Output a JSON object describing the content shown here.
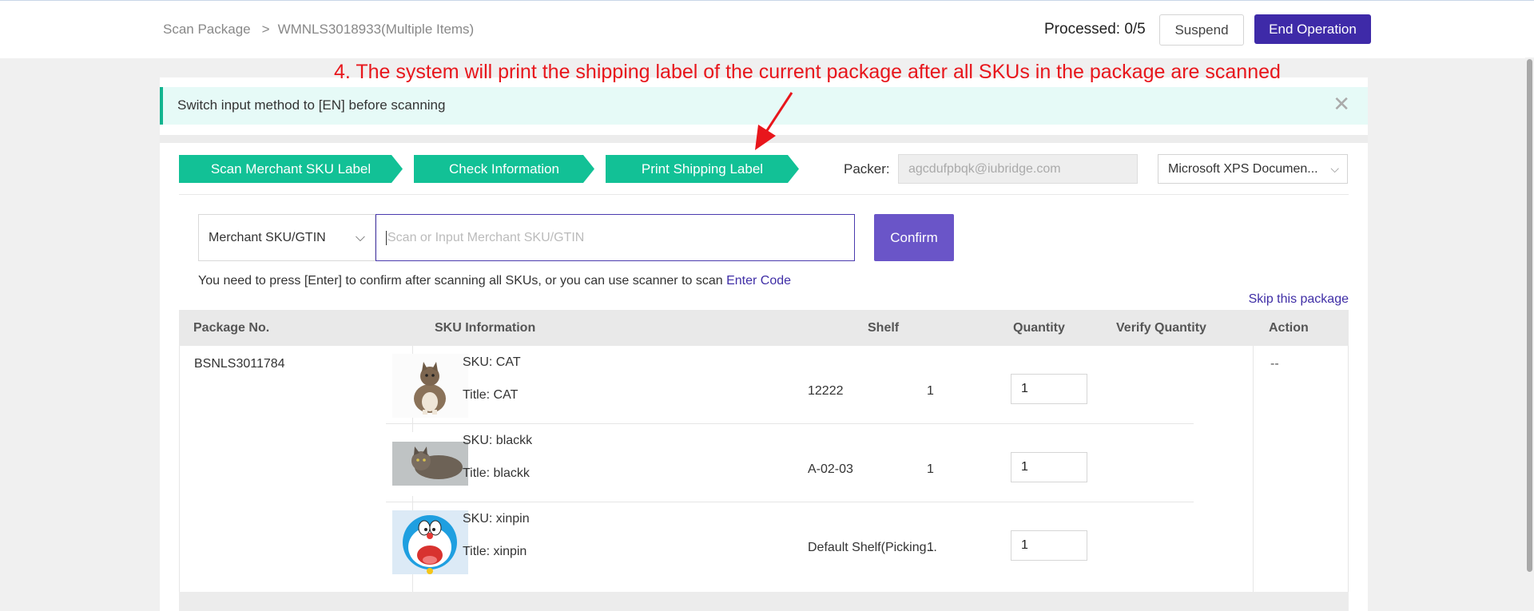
{
  "header": {
    "breadcrumb_root": "Scan Package",
    "breadcrumb_sep": ">",
    "breadcrumb_current": "WMNLS3018933(Multiple Items)",
    "processed": "Processed: 0/5",
    "suspend_label": "Suspend",
    "end_label": "End Operation"
  },
  "annotation": "4. The system will print the shipping label of the current package after all SKUs in the package are scanned",
  "notice": {
    "text": "Switch input method to [EN] before scanning",
    "close": "✕"
  },
  "steps": [
    "Scan Merchant SKU Label",
    "Check Information",
    "Print Shipping Label"
  ],
  "packer": {
    "label": "Packer:",
    "value": "agcdufpbqk@iubridge.com"
  },
  "printer": {
    "value": "Microsoft XPS Documen..."
  },
  "scan": {
    "type_value": "Merchant SKU/GTIN",
    "placeholder": "Scan or Input Merchant SKU/GTIN",
    "confirm_label": "Confirm",
    "hint_text": "You need to press [Enter] to confirm after scanning all SKUs, or you can use scanner to scan ",
    "hint_link": "Enter Code",
    "skip_label": "Skip this package"
  },
  "table": {
    "headers": [
      "Package No.",
      "SKU Information",
      "Shelf",
      "Quantity",
      "Verify Quantity",
      "Action"
    ],
    "package_no": "BSNLS3011784",
    "action": "--",
    "rows": [
      {
        "sku": "SKU: CAT",
        "title": "Title: CAT",
        "shelf": "12222",
        "qty": "1",
        "verify": "1",
        "image": "cat-sitting"
      },
      {
        "sku": "SKU: blackk",
        "title": "Title: blackk",
        "shelf": "A-02-03",
        "qty": "1",
        "verify": "1",
        "image": "cat-lying"
      },
      {
        "sku": "SKU: xinpin",
        "title": "Title: xinpin",
        "shelf": "Default Shelf(Picking...",
        "qty": "1",
        "verify": "1",
        "image": "doraemon"
      }
    ]
  },
  "colors": {
    "primary": "#3e2aa8",
    "step_green": "#12c196",
    "annotation_red": "#e8161c"
  }
}
